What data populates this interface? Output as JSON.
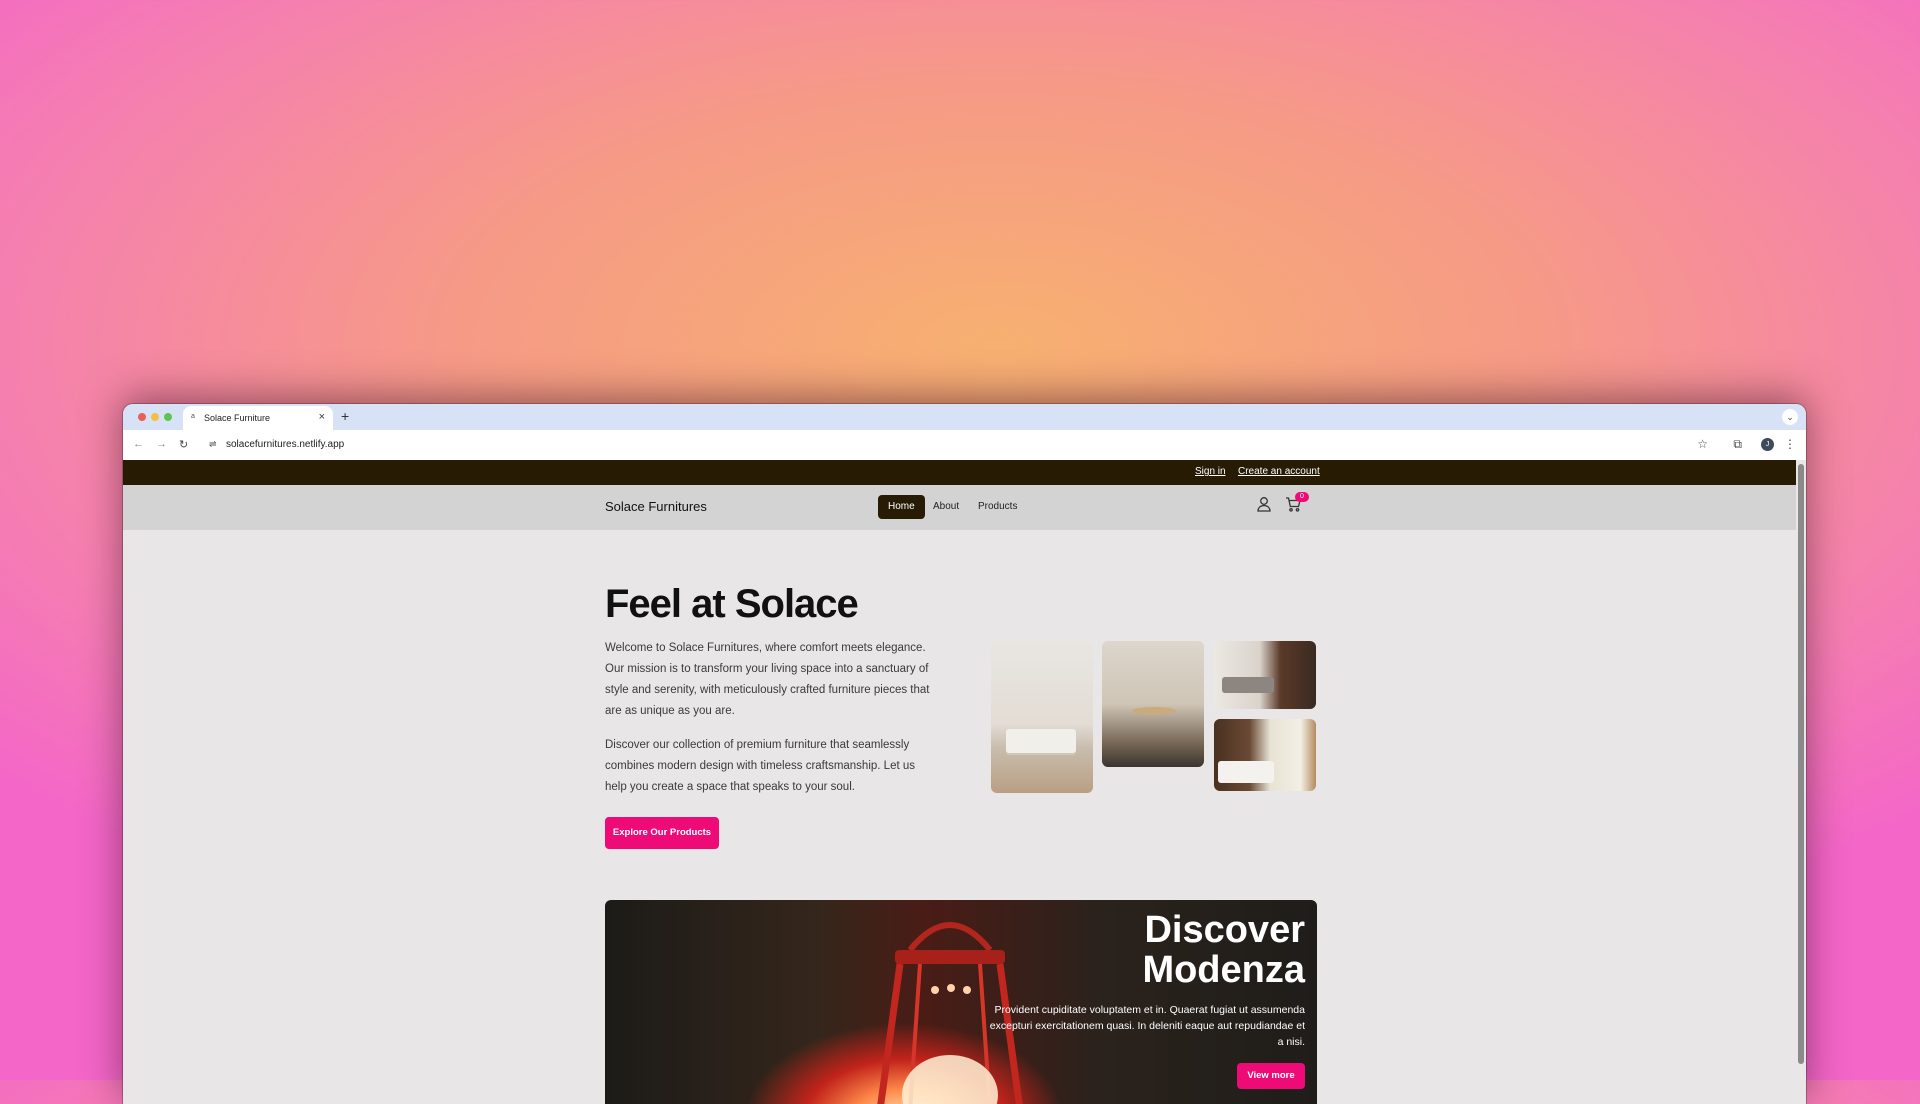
{
  "browser": {
    "tab_title": "Solace Furniture",
    "tab_favicon": "a",
    "close_glyph": "×",
    "new_tab_glyph": "+",
    "tab_menu_glyph": "⌄",
    "url": "solacefurnitures.netlify.app",
    "back_glyph": "←",
    "forward_glyph": "→",
    "reload_glyph": "↻",
    "site_info_glyph": "⇌",
    "star_glyph": "☆",
    "extensions_glyph": "⧉",
    "profile_initial": "J",
    "menu_glyph": "⋮"
  },
  "topbar": {
    "sign_in": "Sign in",
    "create_account": "Create an account"
  },
  "nav": {
    "brand": "Solace Furnitures",
    "links": [
      "Home",
      "About",
      "Products"
    ],
    "active": "Home",
    "cart_count": "0"
  },
  "hero": {
    "title": "Feel at Solace",
    "paragraph_1": "Welcome to Solace Furnitures, where comfort meets elegance. Our mission is to transform your living space into a sanctuary of style and serenity, with meticulously crafted furniture pieces that are as unique as you are.",
    "paragraph_2": "Discover our collection of premium furniture that seamlessly combines modern design with timeless craftsmanship. Let us help you create a space that speaks to your soul.",
    "cta": "Explore Our Products"
  },
  "banner": {
    "title": "Discover Modenza",
    "text": "Provident cupiditate voluptatem et in. Quaerat fugiat ut assumenda excepturi exercitationem quasi. In deleniti eaque aut repudiandae et a nisi.",
    "button": "View more"
  },
  "colors": {
    "accent": "#ee0a77",
    "dark": "#281b04",
    "navbar": "#d3d3d3",
    "page_bg": "#e8e6e7"
  }
}
